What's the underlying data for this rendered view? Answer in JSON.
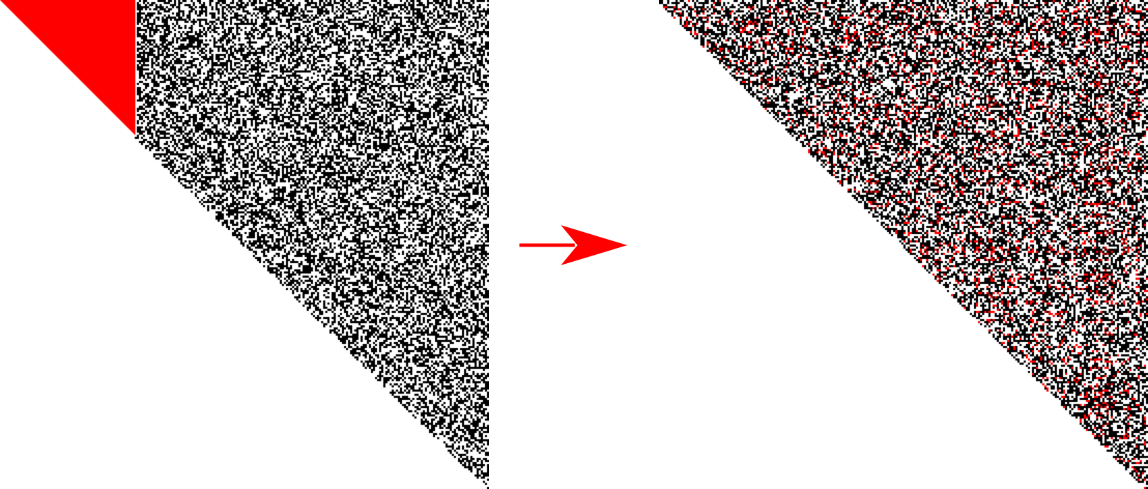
{
  "colors": {
    "accent": "#ff0000",
    "dark": "#000000",
    "light": "#ffffff"
  },
  "left_panel": {
    "pattern": "random-binary-noise",
    "shape": "upper-right-triangle",
    "highlighted_corner": "top-left",
    "highlight_color": "#ff0000"
  },
  "right_panel": {
    "pattern": "random-binary-noise-with-red-scatter",
    "shape": "upper-right-triangle"
  },
  "arrow": {
    "direction": "right",
    "color": "#ff0000",
    "icon": "right-arrow-icon"
  }
}
